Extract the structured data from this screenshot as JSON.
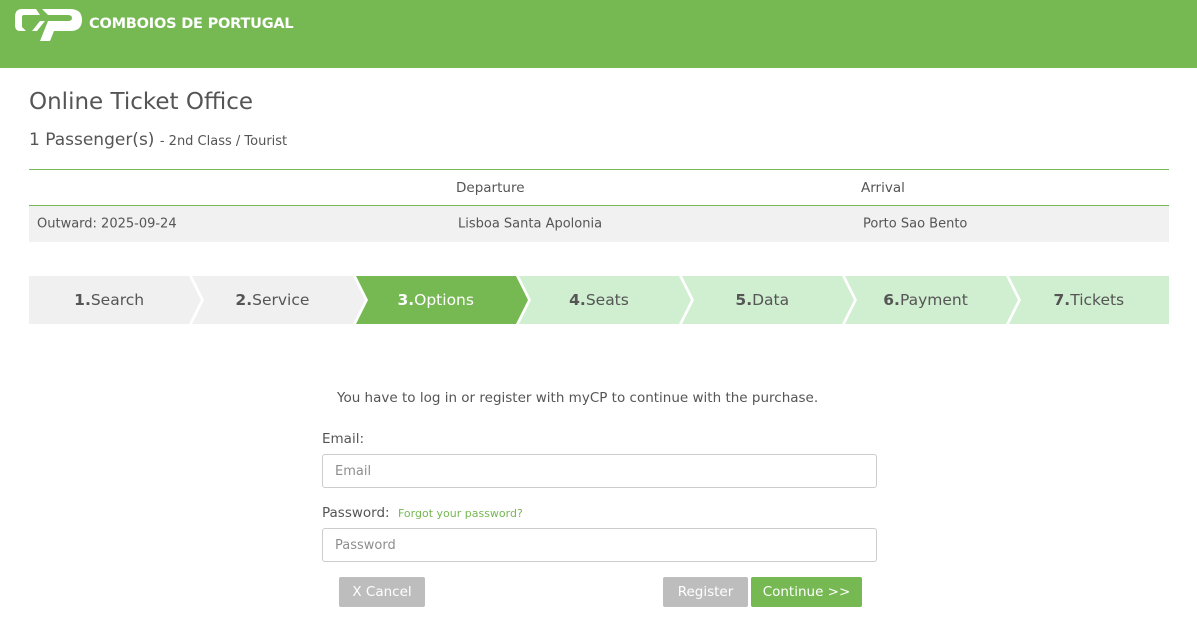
{
  "header": {
    "brand": "COMBOIOS DE PORTUGAL",
    "logo_icon": "cp-logo-icon",
    "bg_color": "#76b852"
  },
  "page": {
    "title": "Online Ticket Office",
    "passengers": "1 Passenger(s)",
    "class_info": "- 2nd Class / Tourist"
  },
  "trip": {
    "columns": [
      "",
      "Departure",
      "Arrival"
    ],
    "rows": [
      {
        "label": "Outward: 2025-09-24",
        "departure": "Lisboa Santa Apolonia",
        "arrival": "Porto Sao Bento"
      }
    ]
  },
  "steps": [
    {
      "num": "1.",
      "label": "Search",
      "state": "done"
    },
    {
      "num": "2.",
      "label": "Service",
      "state": "done"
    },
    {
      "num": "3.",
      "label": "Options",
      "state": "active"
    },
    {
      "num": "4.",
      "label": "Seats",
      "state": "todo"
    },
    {
      "num": "5.",
      "label": "Data",
      "state": "todo"
    },
    {
      "num": "6.",
      "label": "Payment",
      "state": "todo"
    },
    {
      "num": "7.",
      "label": "Tickets",
      "state": "todo"
    }
  ],
  "login": {
    "message": "You have to log in or register with myCP to continue with the purchase.",
    "email_label": "Email:",
    "email_placeholder": "Email",
    "email_value": "",
    "password_label": "Password:",
    "password_placeholder": "Password",
    "password_value": "",
    "forgot_link": "Forgot your password?"
  },
  "buttons": {
    "cancel": "X Cancel",
    "register": "Register",
    "continue": "Continue >>"
  },
  "colors": {
    "accent": "#76b852",
    "step_todo": "#d0eed0",
    "step_done": "#f0f0f0",
    "button_grey": "#bdbdbd"
  }
}
